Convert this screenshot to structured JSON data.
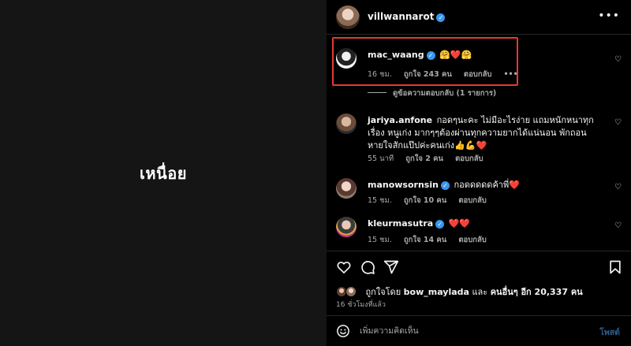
{
  "media": {
    "caption": "เหนื่อย"
  },
  "post": {
    "owner": "villwannarot",
    "more": "•••"
  },
  "comments": [
    {
      "user": "mac_waang",
      "verified": true,
      "text": "🤗❤️🤗",
      "time": "16 ชม.",
      "likes": "ถูกใจ 243 คน",
      "reply": "ตอบกลับ",
      "more": "•••"
    },
    {
      "user": "jariya.anfone",
      "verified": false,
      "text": "กอดๆนะคะ ไม่มีอะไรง่าย แถมหนักหนาทุกเรื่อง หนูเก่ง มากๆๆต้องผ่านทุกความยากได้แน่นอน พักถอนหายใจสักแป๊ปค่ะคนเก่ง👍💪❤️",
      "time": "55 นาที",
      "likes": "ถูกใจ 2 คน",
      "reply": "ตอบกลับ"
    },
    {
      "user": "manowsornsin",
      "verified": true,
      "text": "กอดดดดดค้าพี่❤️",
      "time": "15 ชม.",
      "likes": "ถูกใจ 10 คน",
      "reply": "ตอบกลับ"
    },
    {
      "user": "kleurmasutra",
      "verified": true,
      "text": "❤️❤️",
      "time": "15 ชม.",
      "likes": "ถูกใจ 14 คน",
      "reply": "ตอบกลับ"
    }
  ],
  "view_replies": "ดูข้อความตอบกลับ (1 รายการ)",
  "likes_summary": {
    "prefix": "ถูกใจโดย",
    "user": "bow_maylada",
    "middle": "และ",
    "others": "คนอื่นๆ อีก 20,337 คน"
  },
  "time_ago": "16 ชั่วโมงที่แล้ว",
  "comment_box": {
    "placeholder": "เพิ่มความคิดเห็น",
    "post_label": "โพสต์"
  },
  "icons": {
    "heart": "heart-icon",
    "comment": "comment-icon",
    "share": "share-icon",
    "bookmark": "bookmark-icon",
    "emoji": "emoji-icon",
    "verified": "verified-badge-icon"
  },
  "colors": {
    "highlight": "#e53935",
    "verified": "#3897f0",
    "post_button": "#2f5d8a"
  }
}
